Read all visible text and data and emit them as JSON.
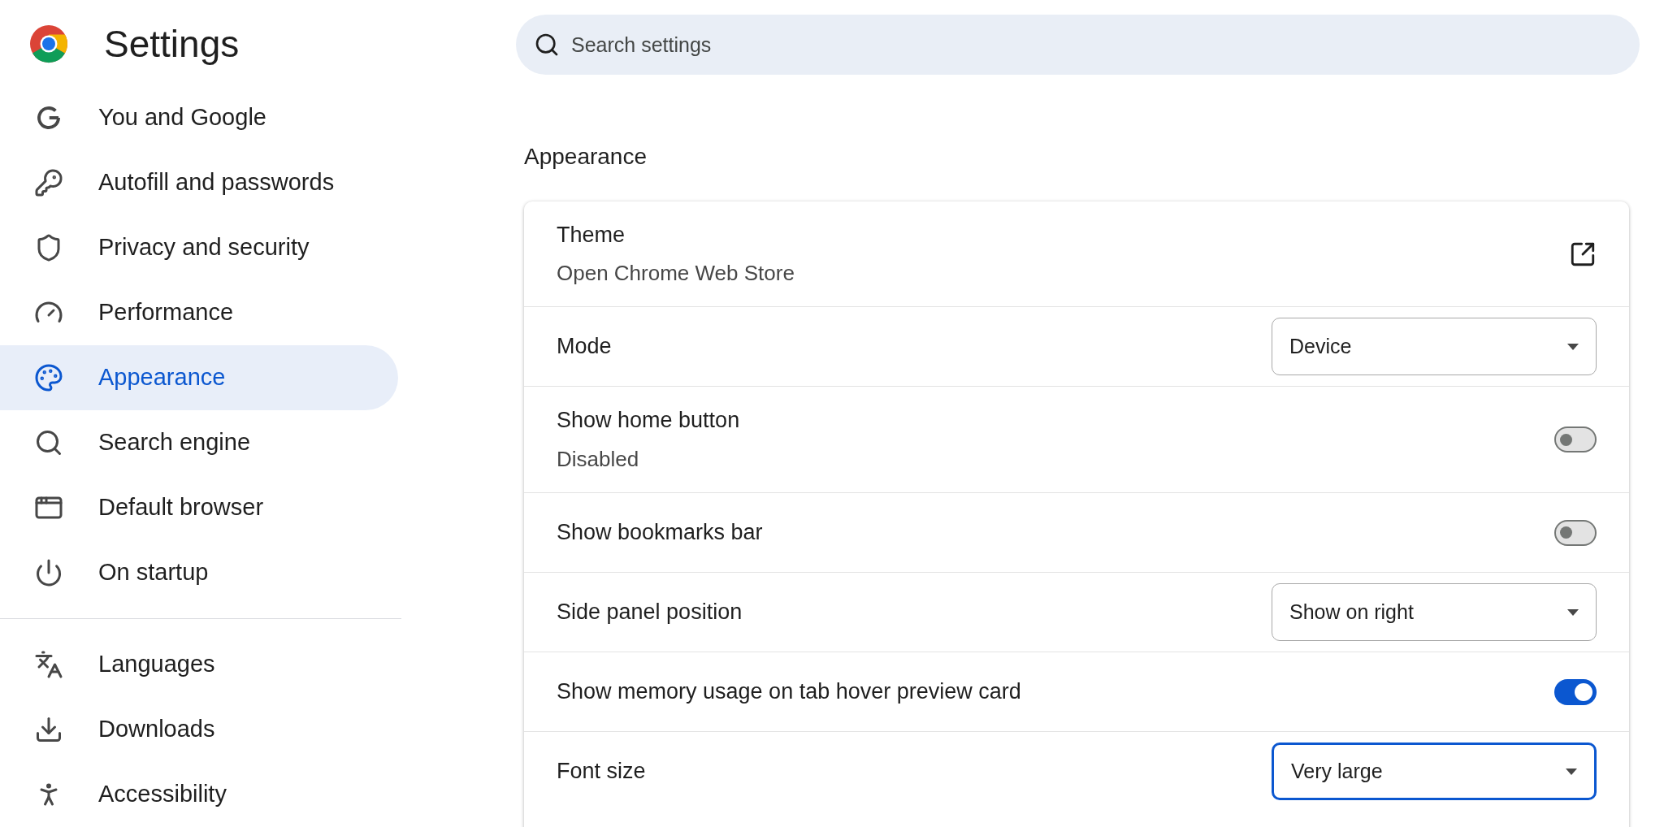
{
  "header": {
    "title": "Settings"
  },
  "search": {
    "placeholder": "Search settings"
  },
  "sidebar": {
    "groups": [
      [
        {
          "label": "You and Google",
          "selected": false
        },
        {
          "label": "Autofill and passwords",
          "selected": false
        },
        {
          "label": "Privacy and security",
          "selected": false
        },
        {
          "label": "Performance",
          "selected": false
        },
        {
          "label": "Appearance",
          "selected": true
        },
        {
          "label": "Search engine",
          "selected": false
        },
        {
          "label": "Default browser",
          "selected": false
        },
        {
          "label": "On startup",
          "selected": false
        }
      ],
      [
        {
          "label": "Languages",
          "selected": false
        },
        {
          "label": "Downloads",
          "selected": false
        },
        {
          "label": "Accessibility",
          "selected": false
        }
      ]
    ]
  },
  "section": {
    "title": "Appearance",
    "rows": [
      {
        "kind": "link",
        "label": "Theme",
        "subtitle": "Open Chrome Web Store"
      },
      {
        "kind": "select",
        "label": "Mode",
        "value": "Device",
        "focused": false
      },
      {
        "kind": "toggle",
        "label": "Show home button",
        "subtitle": "Disabled",
        "on": false
      },
      {
        "kind": "toggle",
        "label": "Show bookmarks bar",
        "on": false
      },
      {
        "kind": "select",
        "label": "Side panel position",
        "value": "Show on right",
        "focused": false
      },
      {
        "kind": "toggle",
        "label": "Show memory usage on tab hover preview card",
        "on": true
      },
      {
        "kind": "select",
        "label": "Font size",
        "value": "Very large",
        "focused": true
      }
    ]
  }
}
